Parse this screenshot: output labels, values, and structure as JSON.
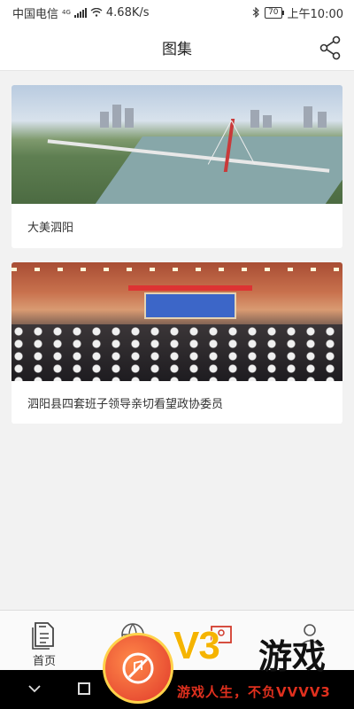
{
  "status_bar": {
    "carrier": "中国电信",
    "network": "4G",
    "speed": "4.68K/s",
    "battery": "70",
    "time": "上午10:00"
  },
  "header": {
    "title": "图集",
    "share_icon": "share-icon"
  },
  "gallery": {
    "items": [
      {
        "caption": "大美泗阳",
        "image": "aerial-city-bridge"
      },
      {
        "caption": "泗阳县四套班子领导亲切看望政协委员",
        "image": "conference-hall"
      }
    ]
  },
  "bottom_nav": {
    "items": [
      {
        "label": "首页",
        "icon": "document-icon"
      },
      {
        "label": "",
        "icon": "globe-icon"
      },
      {
        "label": "",
        "icon": "gallery-icon"
      },
      {
        "label": "",
        "icon": "user-icon"
      }
    ]
  },
  "watermark": {
    "brand": "V3",
    "brand_cn": "游戏",
    "slogan": "游戏人生，不负VVVV3"
  },
  "colors": {
    "accent_watermark": "#f5b400",
    "slogan_red": "#e0301e"
  }
}
